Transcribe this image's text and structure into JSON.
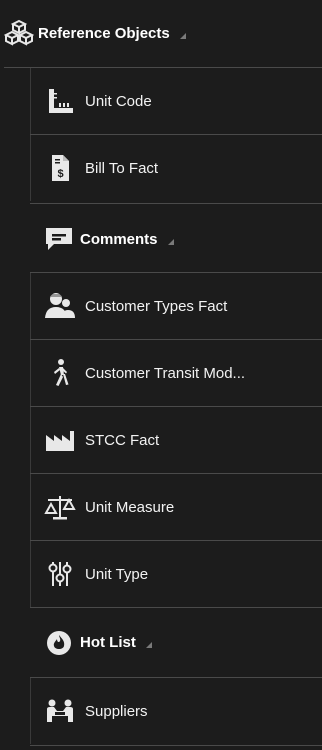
{
  "tree": {
    "reference_objects": {
      "label": "Reference Objects",
      "icon": "cubes-icon",
      "items": [
        {
          "label": "Unit Code",
          "icon": "barcode-icon"
        },
        {
          "label": "Bill To Fact",
          "icon": "invoice-dollar-icon"
        }
      ]
    },
    "comments": {
      "label": "Comments",
      "icon": "comment-icon",
      "items": [
        {
          "label": "Customer Types Fact",
          "icon": "users-icon"
        },
        {
          "label": "Customer Transit Mod...",
          "icon": "walking-icon"
        },
        {
          "label": "STCC Fact",
          "icon": "industry-icon"
        },
        {
          "label": "Unit Measure",
          "icon": "balance-scale-icon"
        },
        {
          "label": "Unit Type",
          "icon": "sliders-icon"
        }
      ]
    },
    "hot_list": {
      "label": "Hot List",
      "icon": "fire-icon",
      "items": [
        {
          "label": "Suppliers",
          "icon": "handshake-icon"
        }
      ]
    }
  },
  "colors": {
    "background": "#1c1c1c",
    "text": "#f2f2f2",
    "divider": "#4a4a4a",
    "caret": "#7a7a7a"
  }
}
